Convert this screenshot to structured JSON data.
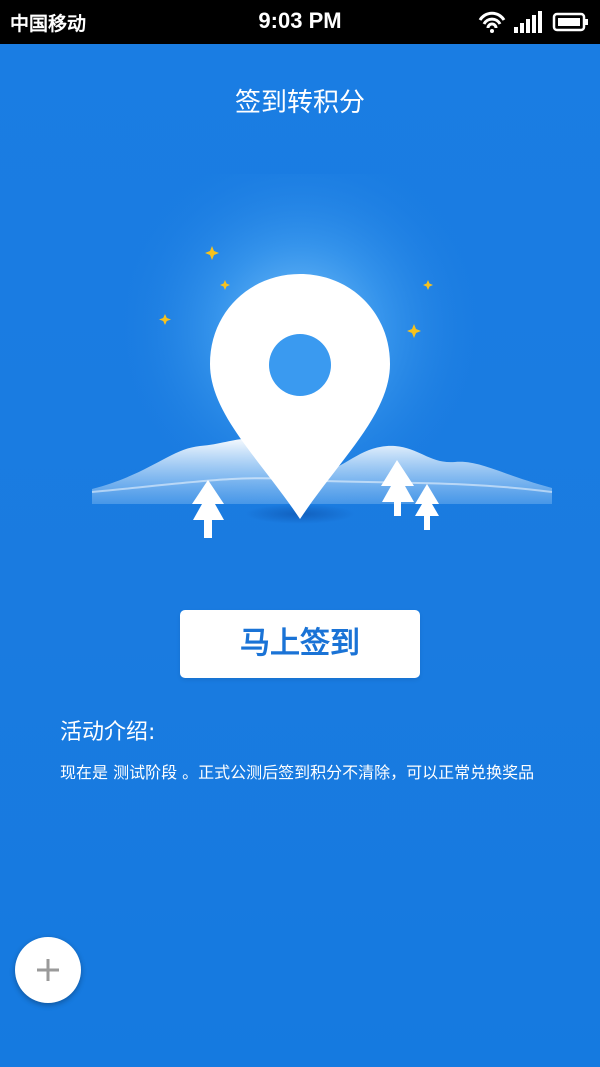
{
  "status_bar": {
    "carrier": "中国移动",
    "time": "9:03 PM"
  },
  "header": {
    "title": "签到转积分"
  },
  "hero": {
    "icons": [
      "location-pin-icon",
      "star-icon",
      "tree-icon",
      "mountain-icon"
    ]
  },
  "main": {
    "checkin_button_label": "马上签到",
    "intro_title": "活动介绍:",
    "intro_text": "现在是 测试阶段 。正式公测后签到积分不清除，可以正常兑换奖品"
  },
  "fab": {
    "icon": "plus-icon"
  },
  "colors": {
    "background": "#1a7be0",
    "button_text": "#1a73d6",
    "star": "#f7c21d"
  }
}
